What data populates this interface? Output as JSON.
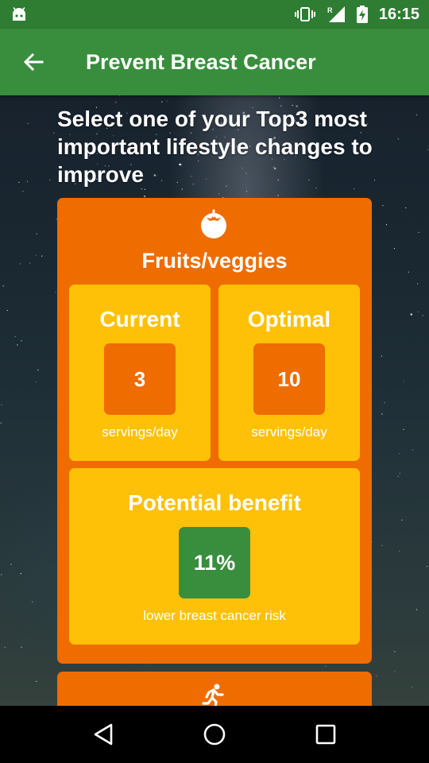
{
  "status_bar": {
    "time": "16:15",
    "icons": [
      "android-debug-icon",
      "vibrate-icon",
      "roaming-signal-icon",
      "battery-charging-icon"
    ]
  },
  "app_bar": {
    "title": "Prevent Breast Cancer",
    "back_icon": "arrow-back-icon"
  },
  "headline": "Select one of your Top3 most important lifestyle changes to improve",
  "card": {
    "icon": "tomato-icon",
    "title": "Fruits/veggies",
    "current": {
      "heading": "Current",
      "value": "3",
      "unit": "servings/day"
    },
    "optimal": {
      "heading": "Optimal",
      "value": "10",
      "unit": "servings/day"
    },
    "benefit": {
      "heading": "Potential benefit",
      "value": "11%",
      "caption": "lower breast cancer risk"
    }
  },
  "next_card": {
    "icon": "running-icon"
  },
  "nav_bar": {
    "back": "nav-back-icon",
    "home": "nav-home-icon",
    "recents": "nav-recents-icon"
  },
  "colors": {
    "status_bar": "#2e7d32",
    "app_bar": "#388e3c",
    "card": "#ef6c00",
    "panel": "#ffc107",
    "benefit_box": "#388e3c"
  }
}
